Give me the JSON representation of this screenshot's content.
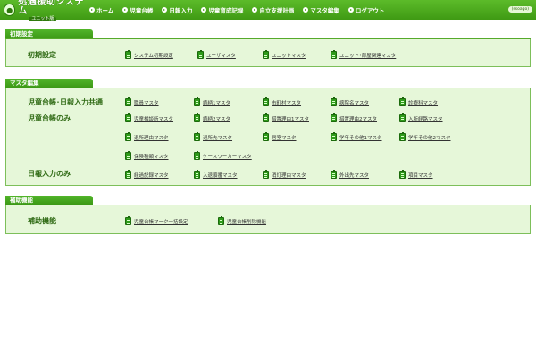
{
  "header": {
    "logo_title": "処遇援助システム",
    "logo_sub": "ユニット版",
    "nav": [
      "ホーム",
      "児童台帳",
      "日報入力",
      "児童育成記録",
      "自立支援計画",
      "マスタ編集",
      "ログアウト"
    ],
    "user": "(ssoago)"
  },
  "sections": {
    "init": {
      "title": "初期設定",
      "row_label": "初期設定",
      "links": [
        "システム初期設定",
        "ユーザマスタ",
        "ユニットマスタ",
        "ユニット･部屋関連マスタ"
      ]
    },
    "master": {
      "title": "マスタ編集",
      "common_label": "児童台帳･日報入力共通",
      "common_links": [
        "職員マスタ",
        "続柄1マスタ",
        "市町村マスタ",
        "病院名マスタ",
        "診療科マスタ"
      ],
      "ledger_label": "児童台帳のみ",
      "ledger_links": [
        "児童相談所マスタ",
        "続柄2マスタ",
        "措置理由1マスタ",
        "措置理由2マスタ",
        "入所経路マスタ",
        "退所理由マスタ",
        "退所先マスタ",
        "居室マスタ",
        "学年その他1マスタ",
        "学年その他2マスタ",
        "保険種類マスタ",
        "ケースワーカーマスタ"
      ],
      "daily_label": "日報入力のみ",
      "daily_links": [
        "経過記録マスタ",
        "入退順番マスタ",
        "消灯理由マスタ",
        "外出先マスタ",
        "項目マスタ"
      ]
    },
    "aux": {
      "title": "補助機能",
      "row_label": "補助機能",
      "links": [
        "児童台帳マーク一括設定",
        "児童台帳削除機能"
      ]
    }
  }
}
